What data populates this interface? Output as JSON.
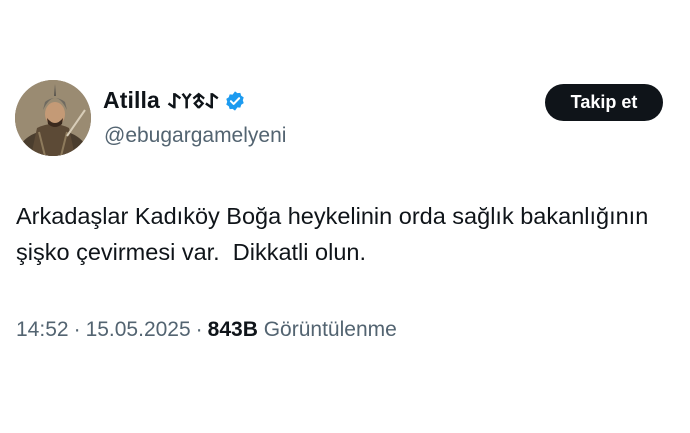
{
  "user": {
    "display_name": "Atilla",
    "display_name_runes": "𐰀𐱃𐰠𐰀",
    "verified_icon": "verified-badge-icon",
    "handle": "@ebugargamelyeni"
  },
  "follow_button": {
    "label": "Takip et"
  },
  "tweet": {
    "text": "Arkadaşlar Kadıköy Boğa heykelinin orda sağlık bakanlığının şişko çevirmesi var.  Dikkatli olun."
  },
  "meta": {
    "time": "14:52",
    "separator": "·",
    "date": "15.05.2025",
    "views_count": "843B",
    "views_label": "Görüntülenme"
  },
  "colors": {
    "primary_text": "#0f1419",
    "secondary_text": "#536471",
    "verified_blue": "#1d9bf0",
    "button_bg": "#0f1419"
  }
}
